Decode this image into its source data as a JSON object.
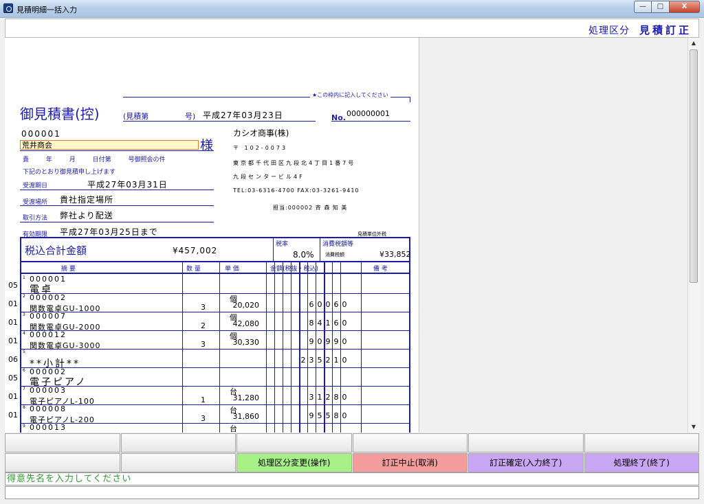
{
  "window": {
    "title": "見積明細一括入力",
    "minimize": "—",
    "maximize": "□",
    "close": "X"
  },
  "header": {
    "mode_label": "処理区分",
    "mode_value": "見積訂正"
  },
  "doc": {
    "guide": "★この枠内に記入してください",
    "title": "御見積書(控)",
    "ref_label": "(見積第",
    "ref_suffix": "号)",
    "date": "平成27年03月23日",
    "no_label": "No.",
    "no_value": "000000001",
    "customer_code": "000001",
    "customer_name": "荒井商会",
    "sama": "様",
    "intro": "貴 年 月 日付第 号御照会の件",
    "intro2": "下記のとおり御見積申し上げます",
    "delivery_date_label": "受渡期日",
    "delivery_date": "平成27年03月31日",
    "delivery_place_label": "受渡場所",
    "delivery_place": "貴社指定場所",
    "terms_label": "取引方法",
    "terms": "弊社より配送",
    "validity_label": "有効期限",
    "validity": "平成27年03月25日まで",
    "company": "カシオ商事(株)",
    "company_zip": "〒 102-0073",
    "company_addr1": "東京都千代田区九段北4丁目1番7号",
    "company_addr2": "九段センタービル4F",
    "company_tel": "TEL:03-6316-4700   FAX:03-3261-9410",
    "company_staff": "担当:000002 斉 森   知 美",
    "unit_note": "見積単位外税",
    "total_label": "税込合計金額",
    "total_value": "¥457,002",
    "tax_rate_label": "税率",
    "tax_rate_value": "8.0%",
    "consumption_label": "消費税額等",
    "consumption_sub": "消費税額",
    "consumption_value": "¥33,852",
    "headers": {
      "desc": "摘     要",
      "qty": "数 量",
      "unit_price": "単 価",
      "amount": "金額(税抜・税込)",
      "notes": "備 考"
    }
  },
  "rows": [
    {
      "cat": "05",
      "no": "1",
      "code": "000001",
      "name": "電卓",
      "big": true,
      "qty": "",
      "unit": "",
      "price": "",
      "amount": ""
    },
    {
      "cat": "01",
      "no": "2",
      "code": "000002",
      "name": "関数電卓GU-1000",
      "big": false,
      "qty": "3",
      "unit": "個",
      "price": "20,020",
      "amount": "60060"
    },
    {
      "cat": "01",
      "no": "3",
      "code": "000007",
      "name": "関数電卓GU-2000",
      "big": false,
      "qty": "2",
      "unit": "個",
      "price": "42,080",
      "amount": "84160"
    },
    {
      "cat": "01",
      "no": "4",
      "code": "000012",
      "name": "関数電卓GU-3000",
      "big": false,
      "qty": "3",
      "unit": "個",
      "price": "30,330",
      "amount": "90990"
    },
    {
      "cat": "06",
      "no": "5",
      "code": "",
      "name": "**小計**",
      "big": true,
      "qty": "",
      "unit": "",
      "price": "",
      "amount": "235210"
    },
    {
      "cat": "05",
      "no": "6",
      "code": "000002",
      "name": "電子ピアノ",
      "big": true,
      "qty": "",
      "unit": "",
      "price": "",
      "amount": ""
    },
    {
      "cat": "01",
      "no": "7",
      "code": "000003",
      "name": "電子ピアノL-100",
      "big": false,
      "qty": "1",
      "unit": "台",
      "price": "31,280",
      "amount": "31280"
    },
    {
      "cat": "01",
      "no": "8",
      "code": "000008",
      "name": "電子ピアノL-200",
      "big": false,
      "qty": "3",
      "unit": "台",
      "price": "31,860",
      "amount": "95580"
    },
    {
      "cat": "",
      "no": "9",
      "code": "000013",
      "name": "",
      "big": false,
      "qty": "",
      "unit": "台",
      "price": "",
      "amount": ""
    }
  ],
  "fkeys_top": [
    "",
    "",
    "",
    "",
    "",
    ""
  ],
  "fkeys_bottom": [
    "",
    "",
    "処理区分変更(操作)",
    "訂正中止(取消)",
    "訂正確定(入力終了)",
    "処理終了(終了)"
  ],
  "message": "得意先名を入力してください",
  "message2": ""
}
